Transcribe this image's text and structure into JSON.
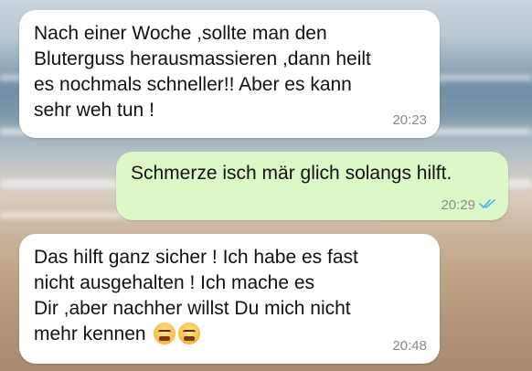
{
  "messages": [
    {
      "direction": "incoming",
      "text": "Nach einer Woche ,sollte man den\nBluterguss herausmassieren ,dann heilt\nes nochmals schneller!!  Aber es kann\nsehr weh tun !",
      "time": "20:23"
    },
    {
      "direction": "outgoing",
      "text": "Schmerze isch mär glich solangs hilft.",
      "time": "20:29",
      "status": "read-double-check"
    },
    {
      "direction": "incoming",
      "text": "Das hilft ganz sicher ! Ich habe es fast\nnicht ausgehalten ! Ich mache es\nDir ,aber nachher willst Du mich nicht\nmehr kennen",
      "emoji": "😤😤",
      "time": "20:48"
    }
  ],
  "colors": {
    "incoming_bubble": "#ffffff",
    "outgoing_bubble": "#dcf8c6",
    "read_checks": "#4fb6ec",
    "timestamp": "#8a8a8a"
  },
  "icons": {
    "read_receipt": "double-check-icon",
    "emoji_face": "face-with-steam-from-nose-icon"
  }
}
